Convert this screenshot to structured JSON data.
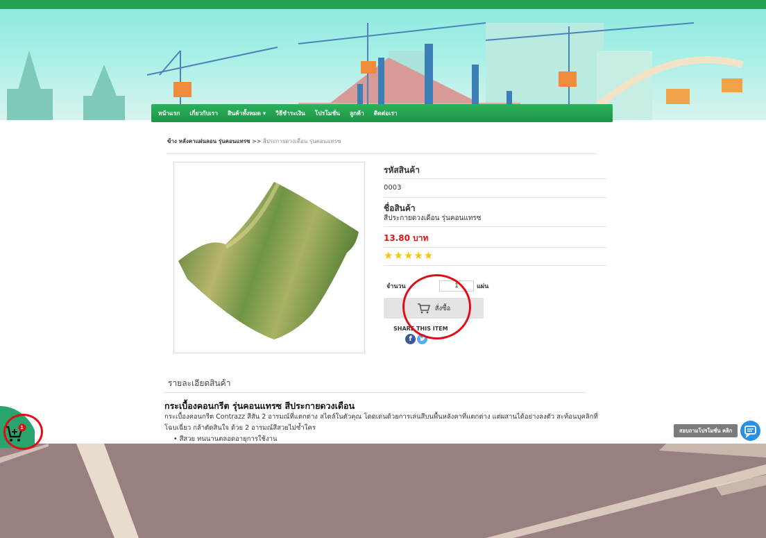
{
  "nav": {
    "items": [
      "หน้าแรก",
      "เกี่ยวกับเรา",
      "สินค้าทั้งหมด",
      "วิธีชำระเงิน",
      "โปรโมชั่น",
      "ลูกค้า",
      "ติดต่อเรา"
    ],
    "dropdown_caret": "▾"
  },
  "breadcrumb": {
    "parent": "ข้าง หลังคาแผ่นลอน รุ่นคอนแทรซ",
    "separator": " >> ",
    "current": "สีประกายดวงเดือน รุ่นคอนแทรซ"
  },
  "product": {
    "code_label": "รหัสสินค้า",
    "code_value": "0003",
    "name_label": "ชื่อสินค้า",
    "name_value": "สีประกายดวงเดือน รุ่นคอนแทรซ",
    "price": "13.80 บาท",
    "rating": 5,
    "stars": "★★★★★",
    "qty_label": "จำนวน",
    "qty_value": "1",
    "qty_unit": "แผ่น",
    "order_label": "สั่งซื้อ",
    "share_label": "SHARE THIS ITEM"
  },
  "details": {
    "section_title": "รายละเอียดสินค้า",
    "heading": "กระเบื้องคอนกรีต รุ่นคอนแทรซ สีประกายดวงเดือน",
    "description": "กระเบื้องคอนกรีต Contrazz สีสัน 2 อารมณ์ที่แตกต่าง สไตล์ในตัวคุณ โดดเด่นด้วยการเล่นสีบนพื้นหลังคาที่แตกต่าง แต่ผสานได้อย่างลงตัว สะท้อนบุคลิกที่โฉบเฉี่ยว กล้าตัดสินใจ ด้วย 2 อารมณ์สีสวยไม่ซ้ำใคร",
    "bullet": "สีสวย ทนนานตลอดอายุการใช้งาน"
  },
  "cart": {
    "badge_count": "1"
  },
  "promo": {
    "label": "สอบถามโปรโมชั่น คลิก"
  },
  "colors": {
    "brand_green": "#27a153",
    "price_red": "#e01212",
    "highlight_red": "#e10d16",
    "star_yellow": "#f7c600",
    "chat_blue": "#2a8fe6"
  },
  "icons": [
    "cart-icon",
    "facebook-icon",
    "twitter-icon",
    "add-to-cart-icon",
    "chat-icon"
  ]
}
